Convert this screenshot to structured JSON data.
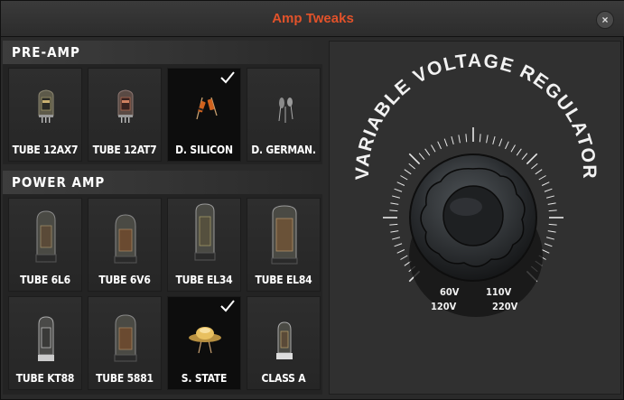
{
  "window": {
    "title": "Amp Tweaks",
    "close_label": "×"
  },
  "preamp": {
    "heading": "PRE-AMP",
    "items": [
      {
        "label": "TUBE 12AX7",
        "icon": "preamp-tube-icon",
        "selected": false
      },
      {
        "label": "TUBE 12AT7",
        "icon": "preamp-tube-icon",
        "selected": false
      },
      {
        "label": "D. SILICON",
        "icon": "silicon-diode-icon",
        "selected": true
      },
      {
        "label": "D. GERMAN.",
        "icon": "germanium-diode-icon",
        "selected": false
      }
    ]
  },
  "power_amp": {
    "heading": "POWER AMP",
    "items": [
      {
        "label": "TUBE 6L6",
        "icon": "power-tube-icon",
        "selected": false
      },
      {
        "label": "TUBE 6V6",
        "icon": "power-tube-icon",
        "selected": false
      },
      {
        "label": "TUBE EL34",
        "icon": "power-tube-icon",
        "selected": false
      },
      {
        "label": "TUBE EL84",
        "icon": "power-tube-icon",
        "selected": false
      },
      {
        "label": "TUBE KT88",
        "icon": "power-tube-icon",
        "selected": false
      },
      {
        "label": "TUBE 5881",
        "icon": "power-tube-icon",
        "selected": false
      },
      {
        "label": "S. STATE",
        "icon": "transistor-icon",
        "selected": true
      },
      {
        "label": "CLASS A",
        "icon": "power-tube-icon",
        "selected": false
      }
    ]
  },
  "regulator": {
    "title": "VARIABLE VOLTAGE REGULATOR",
    "voltage_labels": [
      "60V",
      "120V",
      "110V",
      "220V"
    ]
  },
  "colors": {
    "accent": "#e2522a",
    "text": "#ffffff",
    "tile_bg": "#2b2b2b",
    "selected_bg": "#0d0d0d"
  }
}
